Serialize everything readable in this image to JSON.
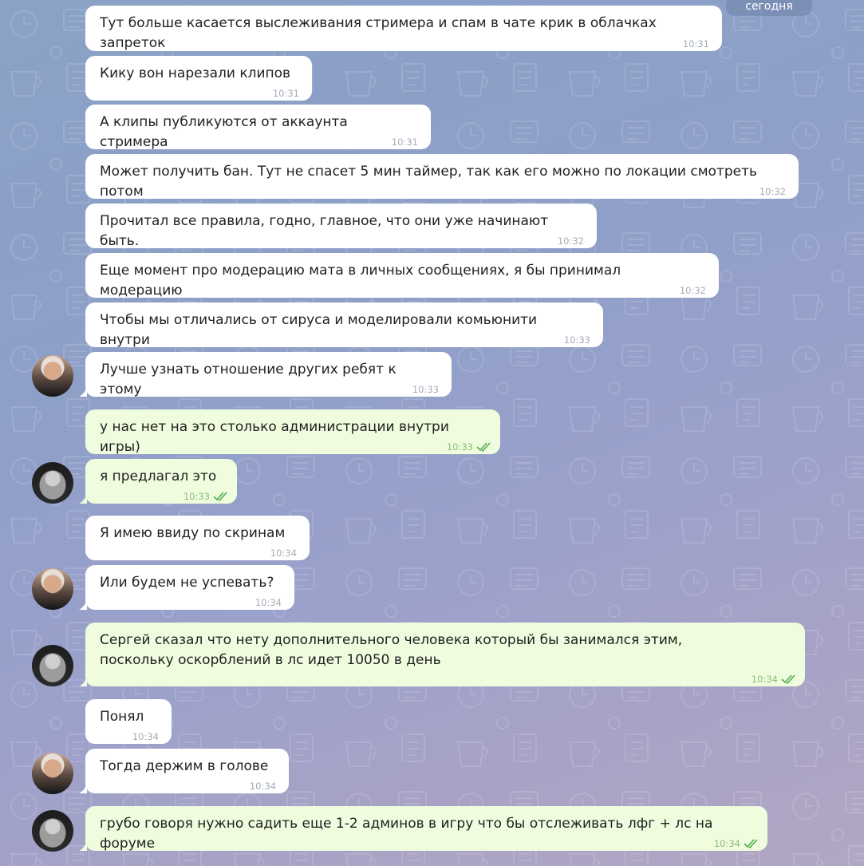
{
  "date_badge": "сегодня",
  "messages": [
    {
      "text": "Тут больше касается выслеживания стримера и спам в чате крик в облачках запреток",
      "time": "10:31"
    },
    {
      "text": "Кику вон нарезали клипов",
      "time": "10:31"
    },
    {
      "text": "А клипы публикуются от аккаунта стримера",
      "time": "10:31"
    },
    {
      "text": "Может получить бан. Тут не спасет 5 мин таймер, так как его можно по локации смотреть потом",
      "time": "10:32"
    },
    {
      "text": "Прочитал все правила, годно, главное, что они уже начинают быть.",
      "time": "10:32"
    },
    {
      "text": "Еще момент про модерацию мата в личных сообщениях, я бы принимал модерацию",
      "time": "10:32"
    },
    {
      "text": "Чтобы мы отличались от сируса и моделировали комьюнити внутри",
      "time": "10:33"
    },
    {
      "text": "Лучше узнать отношение других ребят к этому",
      "time": "10:33"
    },
    {
      "text": "у нас нет на это столько администрации внутри игры)",
      "time": "10:33"
    },
    {
      "text": "я предлагал это",
      "time": "10:33"
    },
    {
      "text": "Я имею ввиду по скринам",
      "time": "10:34"
    },
    {
      "text": "Или будем не успевать?",
      "time": "10:34"
    },
    {
      "text": "Сергей сказал что нету дополнительного человека который бы занимался этим, поскольку оскорблений в лс идет 10050 в день",
      "time": "10:34"
    },
    {
      "text": "Понял",
      "time": "10:34"
    },
    {
      "text": "Тогда держим в голове",
      "time": "10:34"
    },
    {
      "text": "грубо говоря нужно садить еще 1-2 админов в игру что бы отслеживать лфг + лс на форуме",
      "time": "10:34"
    }
  ],
  "colors": {
    "incoming_bubble": "#ffffff",
    "outgoing_bubble": "#effdde",
    "read_check": "#4fae4e",
    "date_badge_bg": "#6e80a5"
  },
  "icons": {
    "read_receipt": "double-check-icon",
    "avatar_a": "avatar-man-icon",
    "avatar_b": "avatar-woman-icon"
  }
}
